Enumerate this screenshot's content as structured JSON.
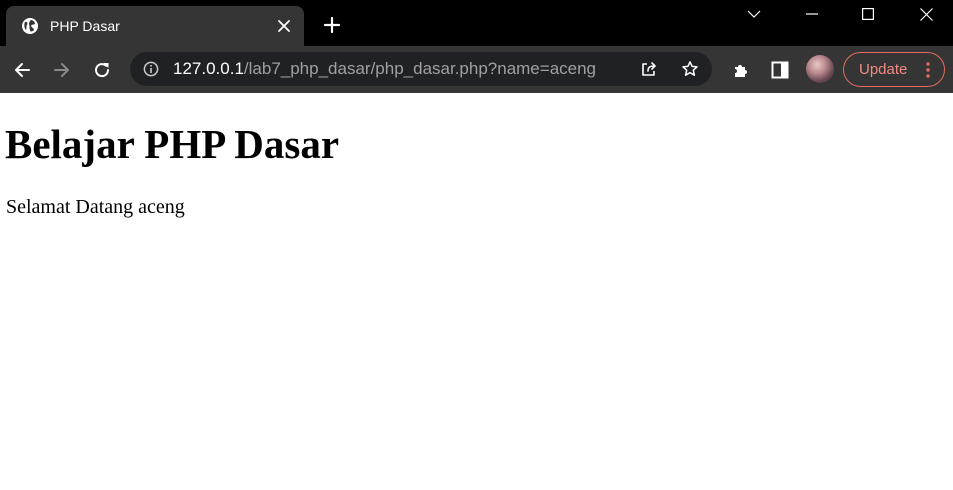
{
  "browser": {
    "tab": {
      "title": "PHP Dasar",
      "favicon": "globe-icon"
    },
    "new_tab_icon": "plus-icon",
    "window_controls": [
      "chevron-down-icon",
      "minimize-icon",
      "maximize-icon",
      "close-icon"
    ],
    "address_bar": {
      "host": "127.0.0.1",
      "path": "/lab7_php_dasar/php_dasar.php?name=aceng",
      "site_info_icon": "info-icon"
    },
    "nav_icons": [
      "back-arrow-icon",
      "forward-arrow-icon",
      "reload-icon"
    ],
    "toolbar_icons": [
      "share-icon",
      "star-icon",
      "puzzle-icon",
      "side-panel-icon"
    ],
    "update_button": {
      "label": "Update",
      "menu_icon": "kebab-menu-icon"
    },
    "colors": {
      "titlebar": "#000000",
      "toolbar": "#353535",
      "omnibox": "#202124",
      "update_accent": "#e26d5f"
    }
  },
  "page": {
    "heading": "Belajar PHP Dasar",
    "greeting": "Selamat Datang aceng"
  }
}
